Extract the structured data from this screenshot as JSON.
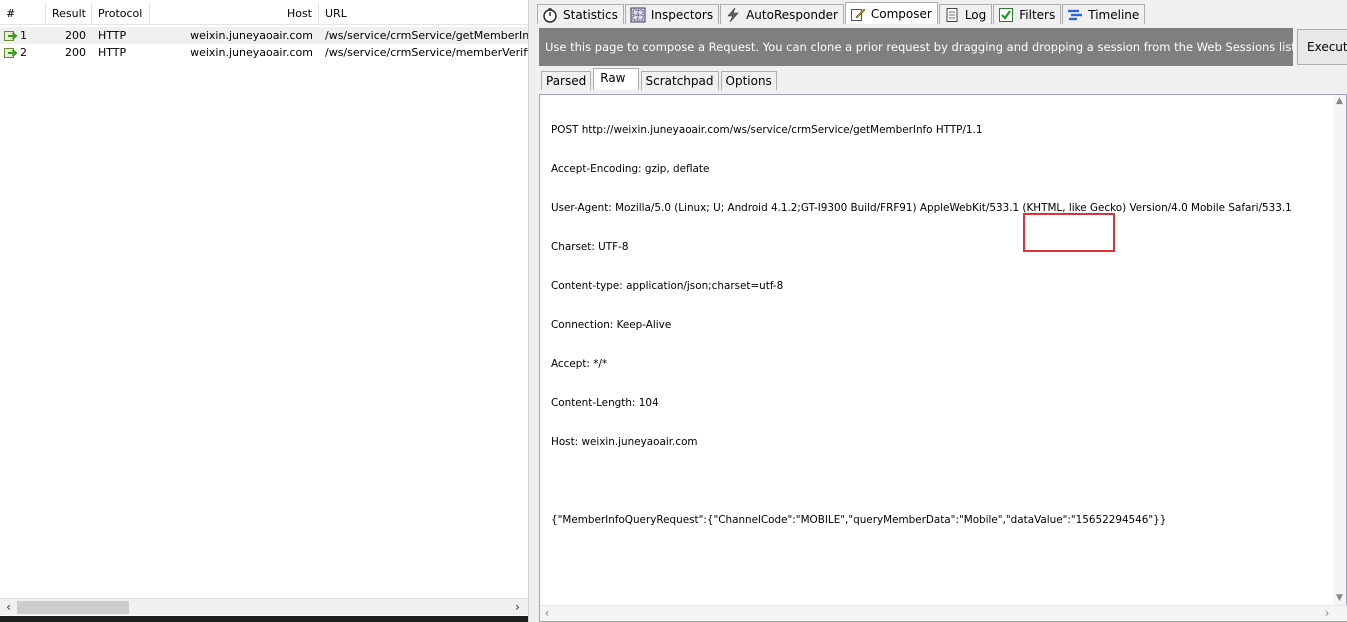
{
  "sessions": {
    "columns": [
      "#",
      "Result",
      "Protocol",
      "Host",
      "URL"
    ],
    "rows": [
      {
        "num": "1",
        "result": "200",
        "protocol": "HTTP",
        "host": "weixin.juneyaoair.com",
        "url": "/ws/service/crmService/getMemberInfo"
      },
      {
        "num": "2",
        "result": "200",
        "protocol": "HTTP",
        "host": "weixin.juneyaoair.com",
        "url": "/ws/service/crmService/memberVerification"
      }
    ]
  },
  "tabs": [
    {
      "label": "Statistics",
      "icon": "stopwatch-icon"
    },
    {
      "label": "Inspectors",
      "icon": "inspect-icon"
    },
    {
      "label": "AutoResponder",
      "icon": "lightning-icon"
    },
    {
      "label": "Composer",
      "icon": "pencil-icon",
      "active": true
    },
    {
      "label": "Log",
      "icon": "document-icon"
    },
    {
      "label": "Filters",
      "icon": "checkbox-icon"
    },
    {
      "label": "Timeline",
      "icon": "timeline-icon"
    }
  ],
  "composer": {
    "banner": "Use this page to compose a Request. You can clone a prior request by dragging and dropping a session from the Web Sessions list.",
    "execute_label": "Execute",
    "subtabs": [
      "Parsed",
      "Raw",
      "Scratchpad",
      "Options"
    ],
    "active_subtab": "Raw",
    "raw_lines": [
      "POST http://weixin.juneyaoair.com/ws/service/crmService/getMemberInfo HTTP/1.1",
      "Accept-Encoding: gzip, deflate",
      "User-Agent: Mozilla/5.0 (Linux; U; Android 4.1.2;GT-I9300 Build/FRF91) AppleWebKit/533.1 (KHTML, like Gecko) Version/4.0 Mobile Safari/533.1",
      "Charset: UTF-8",
      "Content-type: application/json;charset=utf-8",
      "Connection: Keep-Alive",
      "Accept: */*",
      "Content-Length: 104",
      "Host: weixin.juneyaoair.com",
      "",
      "{\"MemberInfoQueryRequest\":{\"ChannelCode\":\"MOBILE\",\"queryMemberData\":\"Mobile\",\"dataValue\":\"15652294546\"}}"
    ]
  },
  "colors": {
    "banner_bg": "#7f7f7f",
    "highlight_border": "#e0303a",
    "selected_row_bg": "#f0f0f0"
  }
}
